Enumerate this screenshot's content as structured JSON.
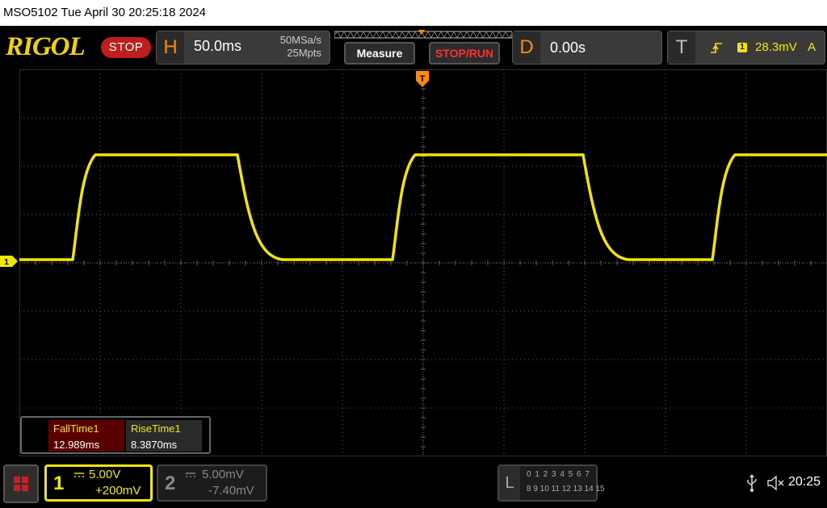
{
  "title_bar": {
    "text": "MSO5102  Tue April 30 20:25:18 2024"
  },
  "header": {
    "logo": "RIGOL",
    "status": "STOP",
    "horizontal": {
      "letter": "H",
      "timebase": "50.0ms",
      "sample_rate": "50MSa/s",
      "memory_depth": "25Mpts"
    },
    "measure_button": "Measure",
    "stop_run_button": "STOP/RUN",
    "delay": {
      "letter": "D",
      "value": "0.00s"
    },
    "trigger": {
      "letter": "T",
      "channel": "1",
      "level": "28.3mV",
      "mode": "A",
      "edge_icon": "rising-edge-icon"
    }
  },
  "display": {
    "trigger_marker": "T",
    "ch1_marker": "1",
    "colors": {
      "ch1": "#f2e600",
      "grid": "#5a5a5a",
      "trigger": "#ff8a00"
    }
  },
  "measurements": [
    {
      "label": "FallTime1",
      "value": "12.989ms"
    },
    {
      "label": "RiseTime1",
      "value": "8.3870ms"
    }
  ],
  "channels": {
    "ch1": {
      "number": "1",
      "scale": "5.00V",
      "offset": "+200mV",
      "active": true
    },
    "ch2": {
      "number": "2",
      "scale": "5.00mV",
      "offset": "-7.40mV",
      "active": false
    }
  },
  "logic": {
    "letter": "L",
    "row1": "0 1 2 3  4 5 6 7",
    "row2": "8 9 10 11 12 13 14 15"
  },
  "status_bar": {
    "time": "20:25",
    "usb_icon": "usb-icon",
    "speaker_icon": "speaker-muted-icon"
  }
}
